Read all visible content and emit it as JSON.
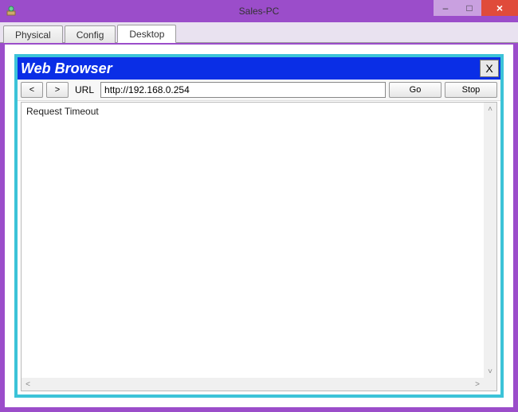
{
  "window": {
    "title": "Sales-PC",
    "min_glyph": "–",
    "max_glyph": "□",
    "close_glyph": "×"
  },
  "tabs": {
    "physical": "Physical",
    "config": "Config",
    "desktop": "Desktop"
  },
  "browser": {
    "title": "Web Browser",
    "close_label": "X",
    "back_label": "<",
    "forward_label": ">",
    "url_label": "URL",
    "url_value": "http://192.168.0.254",
    "go_label": "Go",
    "stop_label": "Stop",
    "body_text": "Request Timeout"
  },
  "scroll": {
    "up": "˄",
    "down": "˅",
    "left": "˂",
    "right": "˃"
  }
}
